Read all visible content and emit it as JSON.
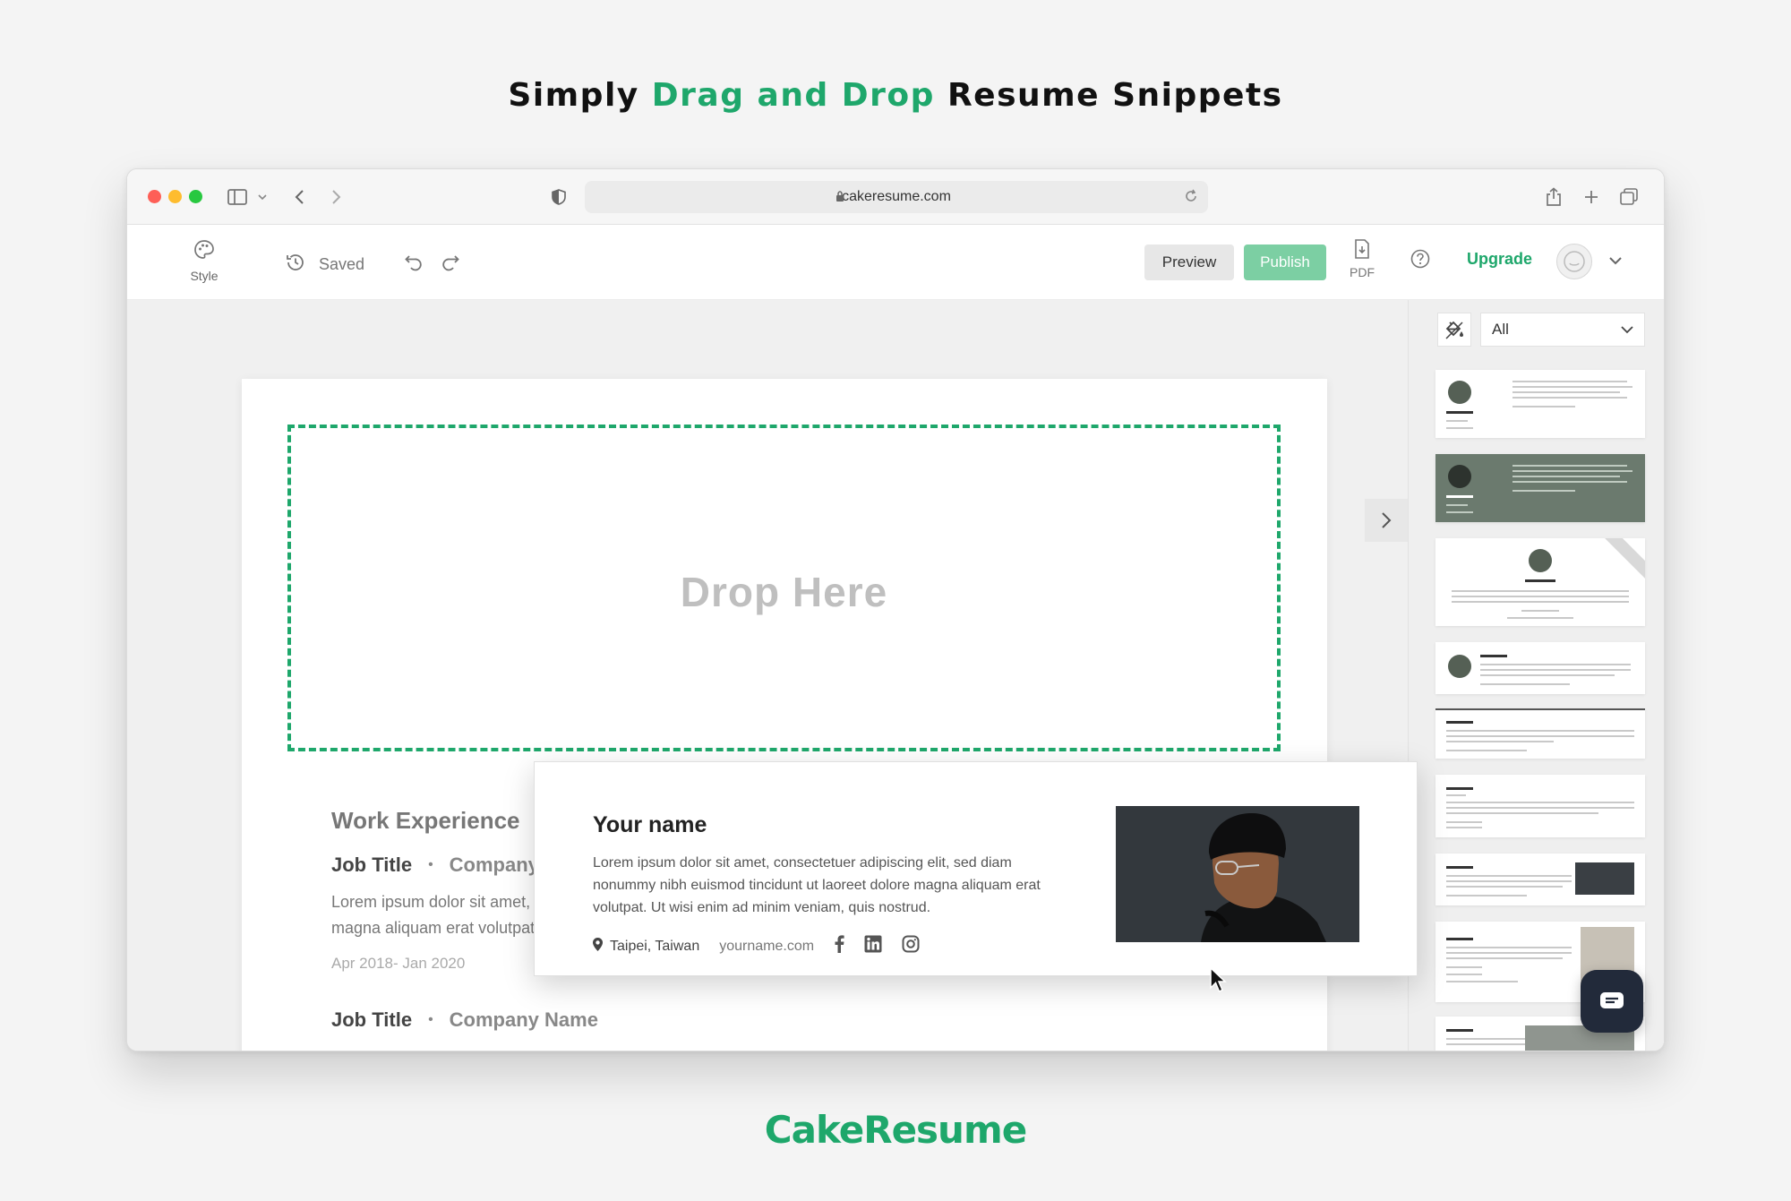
{
  "headline": {
    "prefix": "Simply",
    "accent": "Drag and Drop",
    "suffix": "Resume Snippets"
  },
  "browser": {
    "url": "cakeresume.com"
  },
  "toolbar": {
    "style_label": "Style",
    "saved_label": "Saved",
    "preview_label": "Preview",
    "publish_label": "Publish",
    "pdf_label": "PDF",
    "upgrade_label": "Upgrade"
  },
  "canvas": {
    "drop_text": "Drop Here",
    "work_title": "Work Experience",
    "jobs": [
      {
        "title": "Job Title",
        "company": "Company Name",
        "desc": "Lorem ipsum dolor sit amet, consectetuer adipiscing elit, sed diam nonummy nibh euismod tincidunt ut laoreet dolore magna aliquam erat volutpat.",
        "date": "Apr 2018- Jan 2020"
      },
      {
        "title": "Job Title",
        "company": "Company Name"
      }
    ]
  },
  "snippet": {
    "name": "Your name",
    "desc": "Lorem ipsum dolor sit amet, consectetuer adipiscing elit, sed diam nonummy nibh euismod tincidunt ut laoreet dolore magna aliquam erat volutpat. Ut wisi enim ad minim veniam, quis nostrud.",
    "location": "Taipei, Taiwan",
    "website": "yourname.com"
  },
  "panel": {
    "filter_value": "All"
  },
  "brand": "CakeResume",
  "colors": {
    "accent": "#1ea76b",
    "publish": "#7ccfa3"
  }
}
